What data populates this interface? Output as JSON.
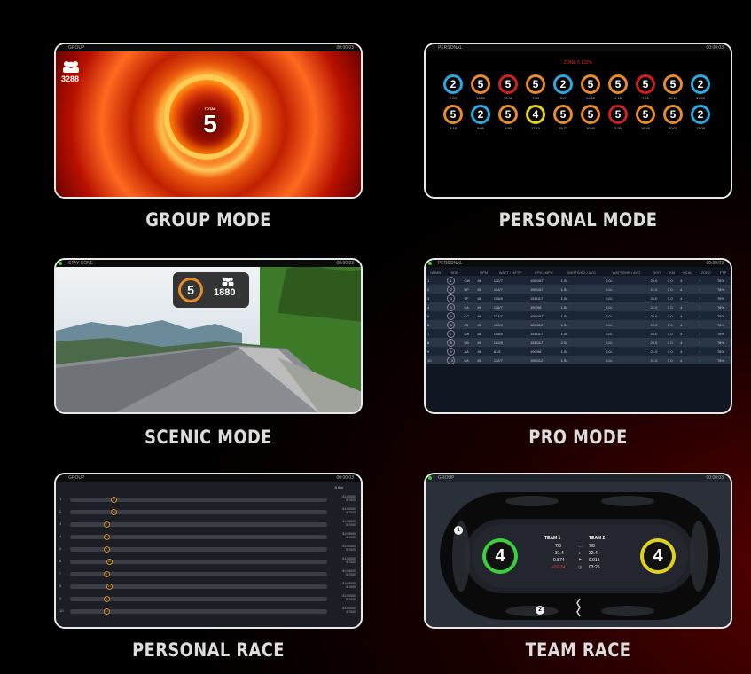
{
  "colors": {
    "accent_orange": "#e88a2a",
    "accent_blue": "#2aa8e0",
    "accent_red": "#d02020",
    "accent_green": "#3ccf3c"
  },
  "cards": [
    {
      "caption": "GROUP MODE",
      "topbar_left": "GROUP",
      "topbar_right": "00:00:03",
      "count": "5",
      "count_label": "TOTAL",
      "group_value": "3288",
      "group_icon": "group-icon"
    },
    {
      "caption": "PERSONAL MODE",
      "topbar_left": "PERSONAL",
      "topbar_right": "00:00:03",
      "headline": "ZONE 5 132%",
      "rings_row1": [
        {
          "v": "2",
          "c": "blue",
          "l": "7:00"
        },
        {
          "v": "5",
          "c": "orange",
          "l": "13:00"
        },
        {
          "v": "5",
          "c": "red",
          "l": "10:30"
        },
        {
          "v": "5",
          "c": "orange",
          "l": "7:50"
        },
        {
          "v": "2",
          "c": "blue",
          "l": "5:0"
        },
        {
          "v": "5",
          "c": "orange",
          "l": "10:12"
        },
        {
          "v": "5",
          "c": "orange",
          "l": "1:15"
        },
        {
          "v": "5",
          "c": "red",
          "l": "7:00"
        },
        {
          "v": "5",
          "c": "orange",
          "l": "10:10"
        },
        {
          "v": "2",
          "c": "blue",
          "l": "17:00"
        }
      ],
      "rings_row2": [
        {
          "v": "5",
          "c": "orange",
          "l": "4:15"
        },
        {
          "v": "2",
          "c": "blue",
          "l": "9:00"
        },
        {
          "v": "5",
          "c": "orange",
          "l": "4:50"
        },
        {
          "v": "4",
          "c": "yellow",
          "l": "17:10"
        },
        {
          "v": "5",
          "c": "orange",
          "l": "15:77"
        },
        {
          "v": "5",
          "c": "orange",
          "l": "10:40"
        },
        {
          "v": "5",
          "c": "red",
          "l": "2:30"
        },
        {
          "v": "5",
          "c": "orange",
          "l": "16:40"
        },
        {
          "v": "5",
          "c": "orange",
          "l": "20:02"
        },
        {
          "v": "2",
          "c": "blue",
          "l": "13:00"
        }
      ]
    },
    {
      "caption": "SCENIC MODE",
      "topbar_left": "STAY CONE",
      "topbar_right": "00:00:03",
      "count": "5",
      "count_label": "TOTAL",
      "group_value": "1880"
    },
    {
      "caption": "PRO MODE",
      "topbar_left": "PERSONAL",
      "topbar_right": "00:00:03",
      "headers": [
        "NUMB",
        "RIDE",
        "",
        "RPM",
        "WATT / %FTP",
        "KPH / MPH",
        "WATTS/KG / AVG",
        "WATTS/HR / AVG",
        "DIST.",
        "KM",
        "KCAL",
        "ZONE",
        "FTP"
      ],
      "rows": [
        [
          "1",
          "1",
          "CW",
          "86",
          "122/7",
          "195/187",
          "1.0/-",
          "0.0/-",
          "20.0",
          "5.0",
          "4",
          "✓",
          "78%"
        ],
        [
          "2",
          "2",
          "BP",
          "86",
          "154/7",
          "195/187",
          "1.0/-",
          "0.0/-",
          "21.0",
          "5.0",
          "4",
          "✓",
          "78%"
        ],
        [
          "3",
          "3",
          "SF",
          "86",
          "155/8",
          "151/117",
          "1.0/-",
          "0.0/-",
          "20.0",
          "5.0",
          "4",
          "✓",
          "78%"
        ],
        [
          "4",
          "4",
          "KA",
          "86",
          "128/7",
          "150/98",
          "1.0/-",
          "0.0/-",
          "21.0",
          "5.0",
          "4",
          "✓",
          "78%"
        ],
        [
          "5",
          "5",
          "CC",
          "86",
          "154/7",
          "195/187",
          "1.0/-",
          "0.0/-",
          "20.0",
          "5.0",
          "4",
          "✓",
          "78%"
        ],
        [
          "6",
          "6",
          "JS",
          "86",
          "182/8",
          "125/112",
          "1.0/-",
          "0.0/-",
          "20.0",
          "5.0",
          "4",
          "✓",
          "78%"
        ],
        [
          "7",
          "7",
          "DA",
          "86",
          "155/8",
          "151/117",
          "1.0/-",
          "0.0/-",
          "20.0",
          "5.0",
          "4",
          "✓",
          "78%"
        ],
        [
          "8",
          "8",
          "KB",
          "86",
          "182/8",
          "151/117",
          "2.0/-",
          "0.0/-",
          "20.0",
          "5.0",
          "4",
          "✓",
          "78%"
        ],
        [
          "9",
          "9",
          "AA",
          "86",
          "81/5",
          "190/98",
          "1.0/-",
          "0.0/-",
          "21.0",
          "5.0",
          "4",
          "✓",
          "78%"
        ],
        [
          "10",
          "10",
          "KA",
          "86",
          "122/7",
          "195/112",
          "1.0/-",
          "0.0/-",
          "21.0",
          "5.0",
          "4",
          "✓",
          "78%"
        ]
      ]
    },
    {
      "caption": "PERSONAL RACE",
      "topbar_left": "GROUP",
      "topbar_right": "00:00:03",
      "distance_label": "5 Km",
      "lanes": [
        {
          "n": "1",
          "pos": 0.16,
          "v": "3",
          "t1": "81:00000",
          "t2": "5.7000"
        },
        {
          "n": "2",
          "pos": 0.16,
          "v": "11",
          "t1": "81:00000",
          "t2": "5.7000"
        },
        {
          "n": "3",
          "pos": 0.13,
          "v": "7",
          "t1": "81:00000",
          "t2": "5.7000"
        },
        {
          "n": "4",
          "pos": 0.13,
          "v": "11",
          "t1": "81:00000",
          "t2": "5.7000"
        },
        {
          "n": "5",
          "pos": 0.13,
          "v": "8",
          "t1": "81:00000",
          "t2": "5.7000"
        },
        {
          "n": "6",
          "pos": 0.14,
          "v": "10",
          "t1": "81:00000",
          "t2": "5.7000"
        },
        {
          "n": "7",
          "pos": 0.13,
          "v": "9",
          "t1": "81:00000",
          "t2": "5.7000"
        },
        {
          "n": "8",
          "pos": 0.14,
          "v": "15",
          "t1": "81:00000",
          "t2": "5.7000"
        },
        {
          "n": "9",
          "pos": 0.13,
          "v": "9",
          "t1": "81:00000",
          "t2": "5.7000"
        },
        {
          "n": "10",
          "pos": 0.13,
          "v": "14",
          "t1": "81:00000",
          "t2": "4.7000"
        }
      ]
    },
    {
      "caption": "TEAM RACE",
      "topbar_left": "GROUP",
      "topbar_right": "00:00:03",
      "team1": {
        "name": "TEAM 1",
        "score": "4",
        "r1": "7/8",
        "r2": "31.4",
        "r3": "0.874",
        "r4": "+00:34"
      },
      "team2": {
        "name": "TEAM 2",
        "score": "4",
        "r1": "7/8",
        "r2": "32.4",
        "r3": "0.015",
        "r4": "03:25"
      },
      "marker_left": "1",
      "marker_bottom": "2"
    }
  ]
}
